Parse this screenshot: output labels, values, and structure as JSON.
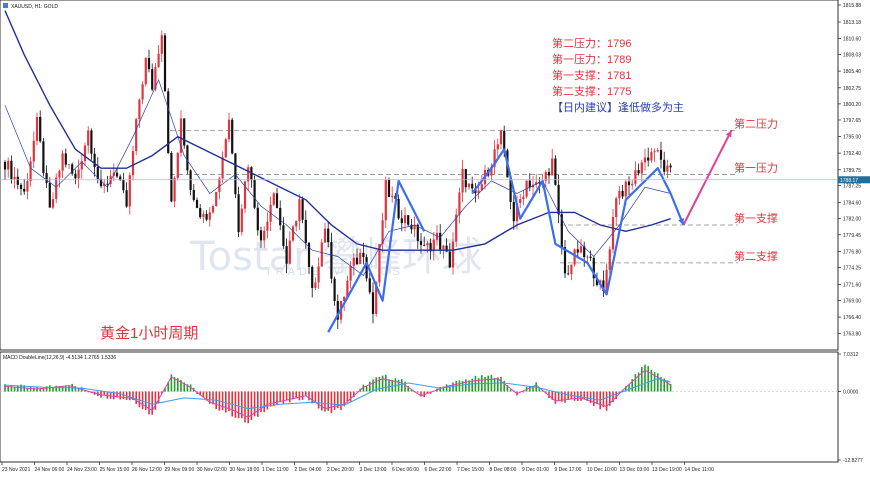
{
  "symbol_title": "XAUUSD, H1:  GOLD",
  "macd_title": "MACD DoubleLine(12,26,9)  -4.5134  1.2765  1.5336",
  "current_price": "1788.17",
  "period_label": "黄金1小时周期",
  "watermark": "Tostar 攀峰环球",
  "watermark_sub": "TRADE WITH US",
  "info": {
    "resistance2": "第二压力：1796",
    "resistance1": "第一压力：1789",
    "support1": "第一支撑：1781",
    "support2": "第二支撑：1775",
    "advice": "【日内建议】逢低做多为主"
  },
  "levels": [
    {
      "name": "第二压力",
      "price": 1796
    },
    {
      "name": "第一压力",
      "price": 1789
    },
    {
      "name": "第一支撑",
      "price": 1781
    },
    {
      "name": "第二支撑",
      "price": 1775
    }
  ],
  "colors": {
    "bull": "#e0353f",
    "bear": "#111111",
    "ma_fast": "#2a3fb0",
    "ma_slow": "#1f2f9a",
    "wave": "#3b6df0",
    "projection": "#e0409c",
    "price_line": "#7fd3d8",
    "macd_pos": "#1ea02a",
    "macd_neg": "#e0353f",
    "macd_line": "#e040b5",
    "signal_line": "#3aa0e8"
  },
  "chart_data": {
    "type": "candlestick",
    "price_axis": {
      "ylim": [
        1761.5,
        1815.88
      ],
      "ticks": [
        "1815.88",
        "1813.18",
        "1810.60",
        "1808.03",
        "1805.40",
        "1802.75",
        "1800.20",
        "1797.65",
        "1795.00",
        "1792.40",
        "1789.75",
        "1787.25",
        "1784.60",
        "1782.00",
        "1779.45",
        "1776.80",
        "1774.25",
        "1771.60",
        "1769.00",
        "1766.40",
        "1763.80"
      ]
    },
    "macd_axis": {
      "ylim": [
        -12.8277,
        7.0312
      ],
      "ticks": [
        "7.0312",
        "0.0000",
        "-12.8277"
      ]
    },
    "time_labels": [
      "23 Nov 2021",
      "24 Nov 06:00",
      "24 Nov 23:00",
      "25 Nov 15:00",
      "26 Nov 12:00",
      "29 Nov 09:00",
      "30 Nov 02:00",
      "30 Nov 18:00",
      "1 Dec 11:00",
      "2 Dec 04:00",
      "2 Dec 20:00",
      "3 Dec 13:00",
      "6 Dec 06:00",
      "6 Dec 22:00",
      "7 Dec 15:00",
      "8 Dec 08:00",
      "9 Dec 01:00",
      "9 Dec 17:00",
      "10 Dec 10:00",
      "13 Dec 03:00",
      "13 Dec 19:00",
      "14 Dec 11:00"
    ],
    "anchors": [
      [
        0,
        1791
      ],
      [
        6,
        1786
      ],
      [
        10,
        1797
      ],
      [
        14,
        1783
      ],
      [
        18,
        1792
      ],
      [
        22,
        1788
      ],
      [
        26,
        1796
      ],
      [
        30,
        1786
      ],
      [
        34,
        1790
      ],
      [
        38,
        1784
      ],
      [
        42,
        1801
      ],
      [
        44,
        1807
      ],
      [
        46,
        1803
      ],
      [
        49,
        1812
      ],
      [
        52,
        1784
      ],
      [
        55,
        1797
      ],
      [
        58,
        1787
      ],
      [
        62,
        1782
      ],
      [
        66,
        1786
      ],
      [
        70,
        1798
      ],
      [
        73,
        1781
      ],
      [
        76,
        1791
      ],
      [
        80,
        1778
      ],
      [
        84,
        1787
      ],
      [
        88,
        1775
      ],
      [
        92,
        1785
      ],
      [
        96,
        1770
      ],
      [
        100,
        1781
      ],
      [
        104,
        1766
      ],
      [
        108,
        1774
      ],
      [
        112,
        1777
      ],
      [
        115,
        1767
      ],
      [
        119,
        1787
      ],
      [
        123,
        1783
      ],
      [
        127,
        1781
      ],
      [
        131,
        1777
      ],
      [
        135,
        1779
      ],
      [
        139,
        1775
      ],
      [
        143,
        1789
      ],
      [
        147,
        1785
      ],
      [
        151,
        1790
      ],
      [
        155,
        1795
      ],
      [
        159,
        1782
      ],
      [
        163,
        1788
      ],
      [
        167,
        1787
      ],
      [
        171,
        1791
      ],
      [
        175,
        1773
      ],
      [
        179,
        1777
      ],
      [
        183,
        1775
      ],
      [
        187,
        1770
      ],
      [
        191,
        1786
      ],
      [
        195,
        1787
      ],
      [
        199,
        1791
      ],
      [
        203,
        1793
      ],
      [
        206,
        1790
      ],
      [
        208,
        1789
      ]
    ],
    "ma_fast": [
      [
        0,
        1800
      ],
      [
        8,
        1790
      ],
      [
        16,
        1787
      ],
      [
        24,
        1791
      ],
      [
        32,
        1787
      ],
      [
        40,
        1795
      ],
      [
        48,
        1804
      ],
      [
        56,
        1792
      ],
      [
        64,
        1786
      ],
      [
        72,
        1789
      ],
      [
        80,
        1784
      ],
      [
        88,
        1781
      ],
      [
        96,
        1777
      ],
      [
        104,
        1776
      ],
      [
        112,
        1773
      ],
      [
        120,
        1780
      ],
      [
        128,
        1781
      ],
      [
        136,
        1779
      ],
      [
        144,
        1784
      ],
      [
        152,
        1788
      ],
      [
        160,
        1786
      ],
      [
        168,
        1788
      ],
      [
        176,
        1780
      ],
      [
        184,
        1776
      ],
      [
        192,
        1781
      ],
      [
        200,
        1787
      ],
      [
        208,
        1786
      ]
    ],
    "ma_slow": [
      [
        0,
        1815
      ],
      [
        6,
        1808
      ],
      [
        14,
        1800
      ],
      [
        22,
        1793
      ],
      [
        30,
        1790
      ],
      [
        38,
        1790
      ],
      [
        46,
        1792
      ],
      [
        54,
        1795
      ],
      [
        62,
        1793
      ],
      [
        70,
        1791
      ],
      [
        78,
        1789
      ],
      [
        86,
        1787
      ],
      [
        94,
        1785
      ],
      [
        102,
        1781
      ],
      [
        110,
        1778
      ],
      [
        118,
        1777
      ],
      [
        130,
        1777
      ],
      [
        140,
        1777
      ],
      [
        150,
        1778
      ],
      [
        160,
        1781
      ],
      [
        170,
        1783
      ],
      [
        178,
        1783
      ],
      [
        186,
        1781
      ],
      [
        194,
        1780
      ],
      [
        202,
        1781
      ],
      [
        208,
        1782
      ]
    ],
    "waves": [
      [
        [
          101,
          1764
        ],
        [
          113,
          1775
        ],
        [
          118,
          1769
        ],
        [
          123,
          1788
        ],
        [
          131,
          1780
        ]
      ],
      [
        [
          146,
          1786
        ],
        [
          152,
          1790
        ],
        [
          156,
          1793
        ],
        [
          161,
          1782
        ],
        [
          168,
          1788
        ],
        [
          172,
          1778
        ],
        [
          182,
          1775
        ],
        [
          188,
          1770
        ],
        [
          194,
          1785
        ],
        [
          204,
          1790
        ],
        [
          208,
          1786
        ],
        [
          212,
          1781
        ]
      ]
    ],
    "projection": [
      [
        212,
        1781
      ],
      [
        221,
        1790
      ],
      [
        227,
        1796
      ]
    ],
    "macd": [
      [
        0,
        1.2
      ],
      [
        10,
        0.6
      ],
      [
        20,
        1.4
      ],
      [
        30,
        -0.8
      ],
      [
        40,
        -1.6
      ],
      [
        46,
        -4.5
      ],
      [
        52,
        3.4
      ],
      [
        58,
        1.0
      ],
      [
        64,
        -2.5
      ],
      [
        70,
        -4.0
      ],
      [
        76,
        -6.0
      ],
      [
        82,
        -3.0
      ],
      [
        88,
        -2.0
      ],
      [
        94,
        -1.0
      ],
      [
        100,
        -4.0
      ],
      [
        106,
        -3.0
      ],
      [
        112,
        1.0
      ],
      [
        118,
        3.0
      ],
      [
        124,
        2.0
      ],
      [
        130,
        -1.0
      ],
      [
        138,
        1.2
      ],
      [
        146,
        2.5
      ],
      [
        154,
        3.0
      ],
      [
        160,
        -0.5
      ],
      [
        166,
        1.5
      ],
      [
        172,
        -2.2
      ],
      [
        180,
        -1.5
      ],
      [
        188,
        -3.5
      ],
      [
        194,
        1.0
      ],
      [
        200,
        5.0
      ],
      [
        206,
        2.5
      ],
      [
        208,
        1.5
      ]
    ],
    "signal": [
      [
        0,
        1.5
      ],
      [
        12,
        1.0
      ],
      [
        24,
        0.8
      ],
      [
        36,
        -0.5
      ],
      [
        46,
        -3.0
      ],
      [
        56,
        -1.5
      ],
      [
        66,
        -2.0
      ],
      [
        76,
        -4.0
      ],
      [
        86,
        -3.0
      ],
      [
        96,
        -2.5
      ],
      [
        106,
        -3.2
      ],
      [
        116,
        0.5
      ],
      [
        126,
        2.0
      ],
      [
        136,
        0.8
      ],
      [
        146,
        1.8
      ],
      [
        156,
        2.0
      ],
      [
        166,
        1.0
      ],
      [
        176,
        -0.8
      ],
      [
        186,
        -2.0
      ],
      [
        196,
        0.8
      ],
      [
        204,
        3.0
      ],
      [
        208,
        2.2
      ]
    ]
  }
}
